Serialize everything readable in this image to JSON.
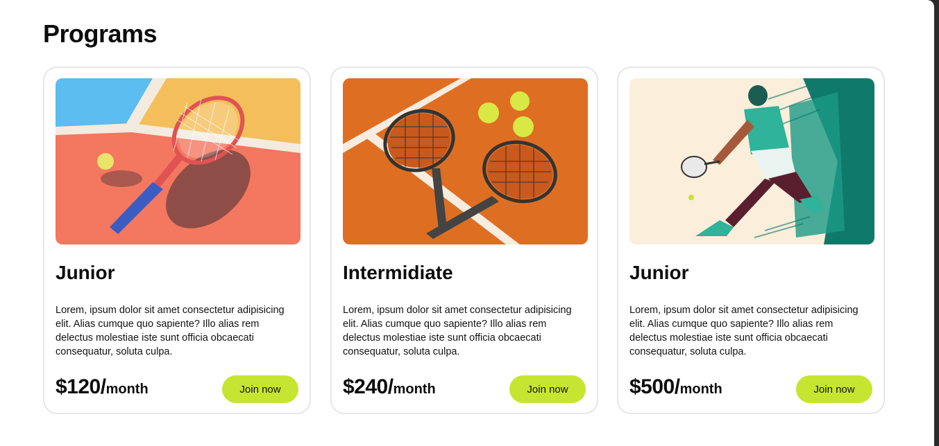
{
  "section": {
    "title": "Programs"
  },
  "cards": [
    {
      "image_icon": "tennis-racket-on-court-illustration",
      "title": "Junior",
      "description": "Lorem, ipsum dolor sit amet consectetur adipisicing elit. Alias cumque quo sapiente? Illo alias rem delectus molestiae iste sunt officia obcaecati consequatur, soluta culpa.",
      "price": "$120/",
      "price_unit": "month",
      "button_label": "Join now"
    },
    {
      "image_icon": "crossed-rackets-and-balls-illustration",
      "title": "Intermidiate",
      "description": "Lorem, ipsum dolor sit amet consectetur adipisicing elit. Alias cumque quo sapiente? Illo alias rem delectus molestiae iste sunt officia obcaecati consequatur, soluta culpa.",
      "price": "$240/",
      "price_unit": "month",
      "button_label": "Join now"
    },
    {
      "image_icon": "tennis-player-illustration",
      "title": "Junior",
      "description": "Lorem, ipsum dolor sit amet consectetur adipisicing elit. Alias cumque quo sapiente? Illo alias rem delectus molestiae iste sunt officia obcaecati consequatur, soluta culpa.",
      "price": "$500/",
      "price_unit": "month",
      "button_label": "Join now"
    }
  ],
  "colors": {
    "accent": "#c6e530",
    "card_border": "#e6e6e6",
    "text": "#0d0d0d"
  }
}
